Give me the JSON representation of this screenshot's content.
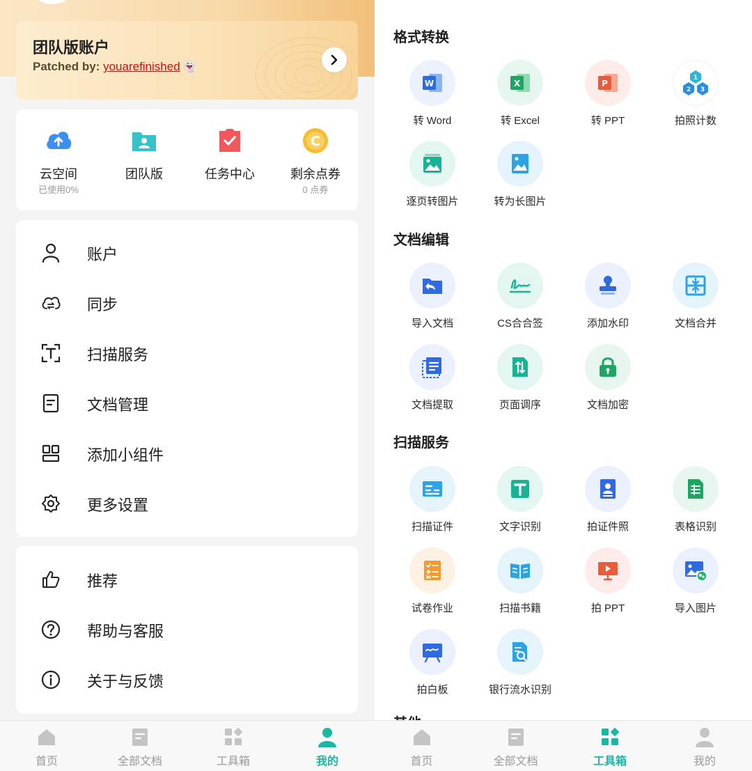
{
  "left": {
    "team_card": {
      "title": "团队版账户",
      "patched_prefix": "Patched by: ",
      "patched_link": "youarefinished",
      "patched_emoji": "👻"
    },
    "quick": [
      {
        "label": "云空间",
        "sub": "已使用0%",
        "icon": "cloud-upload-icon"
      },
      {
        "label": "团队版",
        "sub": "",
        "icon": "team-folder-icon"
      },
      {
        "label": "任务中心",
        "sub": "",
        "icon": "task-check-icon"
      },
      {
        "label": "剩余点券",
        "sub": "0 点券",
        "icon": "coupon-coin-icon"
      }
    ],
    "menu1": [
      {
        "label": "账户",
        "icon": "user-icon"
      },
      {
        "label": "同步",
        "icon": "cloud-sync-icon"
      },
      {
        "label": "扫描服务",
        "icon": "scan-text-icon"
      },
      {
        "label": "文档管理",
        "icon": "document-icon"
      },
      {
        "label": "添加小组件",
        "icon": "widget-icon"
      },
      {
        "label": "更多设置",
        "icon": "gear-icon"
      }
    ],
    "menu2": [
      {
        "label": "推荐",
        "icon": "thumbs-up-icon"
      },
      {
        "label": "帮助与客服",
        "icon": "help-icon"
      },
      {
        "label": "关于与反馈",
        "icon": "info-icon"
      }
    ]
  },
  "right": {
    "sections": [
      {
        "title": "格式转换",
        "tools": [
          {
            "label": "转 Word",
            "icon": "word-icon"
          },
          {
            "label": "转 Excel",
            "icon": "excel-icon"
          },
          {
            "label": "转 PPT",
            "icon": "ppt-icon"
          },
          {
            "label": "拍照计数",
            "icon": "count-icon"
          },
          {
            "label": "逐页转图片",
            "icon": "page-to-image-icon"
          },
          {
            "label": "转为长图片",
            "icon": "long-image-icon"
          }
        ]
      },
      {
        "title": "文档编辑",
        "tools": [
          {
            "label": "导入文档",
            "icon": "import-doc-icon"
          },
          {
            "label": "CS合合签",
            "icon": "signature-icon"
          },
          {
            "label": "添加水印",
            "icon": "stamp-icon"
          },
          {
            "label": "文档合并",
            "icon": "merge-icon"
          },
          {
            "label": "文档提取",
            "icon": "extract-icon"
          },
          {
            "label": "页面调序",
            "icon": "reorder-icon"
          },
          {
            "label": "文档加密",
            "icon": "lock-icon"
          }
        ]
      },
      {
        "title": "扫描服务",
        "tools": [
          {
            "label": "扫描证件",
            "icon": "id-card-icon"
          },
          {
            "label": "文字识别",
            "icon": "ocr-text-icon"
          },
          {
            "label": "拍证件照",
            "icon": "id-photo-icon"
          },
          {
            "label": "表格识别",
            "icon": "table-icon"
          },
          {
            "label": "试卷作业",
            "icon": "exam-icon"
          },
          {
            "label": "扫描书籍",
            "icon": "book-icon"
          },
          {
            "label": "拍 PPT",
            "icon": "presentation-icon"
          },
          {
            "label": "导入图片",
            "icon": "import-image-icon"
          },
          {
            "label": "拍白板",
            "icon": "whiteboard-icon"
          },
          {
            "label": "银行流水识别",
            "icon": "bank-statement-icon"
          }
        ]
      }
    ],
    "cut_title": "其他"
  },
  "nav": {
    "items": [
      {
        "label": "首页",
        "icon": "home-icon"
      },
      {
        "label": "全部文档",
        "icon": "all-docs-icon"
      },
      {
        "label": "工具箱",
        "icon": "toolbox-icon"
      },
      {
        "label": "我的",
        "icon": "profile-icon"
      }
    ]
  },
  "colors": {
    "accent": "#19b7a4",
    "inactive": "#9a9a9a",
    "link_red": "#cc1111"
  }
}
